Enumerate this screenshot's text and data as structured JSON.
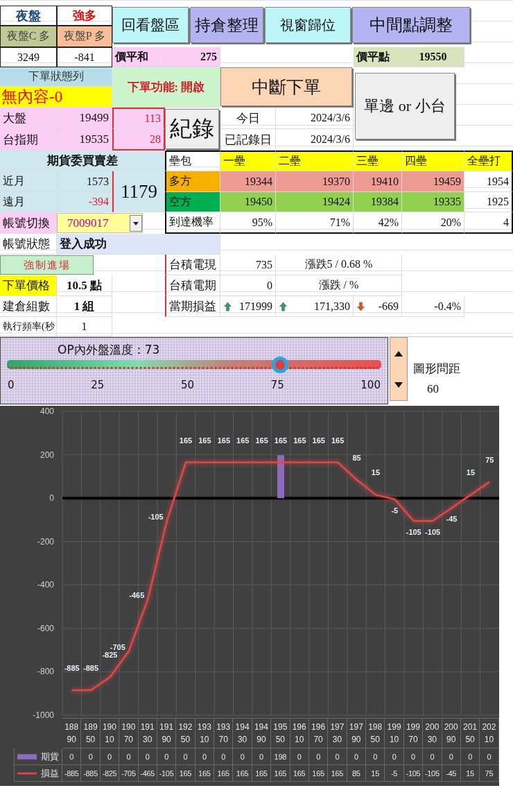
{
  "night": {
    "title": "夜盤",
    "bias": "強多",
    "call_label": "夜盤C 多",
    "put_label": "夜盤P 多",
    "call_value": "3249",
    "put_value": "-841"
  },
  "toolbar_buttons": [
    "回看盤區",
    "持倉整理",
    "視窗歸位",
    "中間點調整"
  ],
  "atm_sum": {
    "label": "價平和",
    "value": "275"
  },
  "atm_point": {
    "label": "價平點",
    "value": "19550"
  },
  "order_status": {
    "header": "下單狀態列",
    "message": "無內容-0"
  },
  "order_function": "下單功能: 開啟",
  "stop_button": "中斷下單",
  "side_button": "單邊 or 小台",
  "record_button": "紀錄",
  "index": [
    {
      "label": "大盤",
      "value": "19499",
      "diff": "113"
    },
    {
      "label": "台指期",
      "value": "19535",
      "diff": "28"
    }
  ],
  "dates": [
    {
      "label": "今日",
      "value": "2024/3/6"
    },
    {
      "label": "已記錄日",
      "value": "2024/3/6"
    }
  ],
  "futures_spread": {
    "header": "期貨委買賣差",
    "rows": [
      {
        "label": "近月",
        "value": "1573",
        "negative": false
      },
      {
        "label": "遠月",
        "value": "-394",
        "negative": true
      }
    ],
    "total": "1179"
  },
  "bases": {
    "header": "壘包",
    "columns": [
      "一壘",
      "二壘",
      "三壘",
      "四壘",
      "全壘打"
    ],
    "rows": [
      {
        "kind": "long",
        "label": "多方",
        "values": [
          "19344",
          "19370",
          "19410",
          "19459",
          "1954"
        ]
      },
      {
        "kind": "short",
        "label": "空方",
        "values": [
          "19450",
          "19424",
          "19384",
          "19335",
          "1925"
        ]
      },
      {
        "kind": "prob",
        "label": "到達機率",
        "values": [
          "95%",
          "71%",
          "42%",
          "20%",
          "4"
        ]
      }
    ]
  },
  "account": {
    "switch_label": "帳號切換",
    "account_value": "7009017",
    "status_label": "帳號狀態",
    "status": "登入成功"
  },
  "force_entry_button": "強制進場",
  "order_price": {
    "label": "下單價格",
    "value": "10.5 點"
  },
  "lots": {
    "label": "建倉組數",
    "value": "1 組"
  },
  "frequency": {
    "label": "執行頻率(秒",
    "value": "1"
  },
  "tsmc": [
    {
      "label": "台積電現",
      "value": "735",
      "change": "漲跌5 / 0.68 %"
    },
    {
      "label": "台積電期",
      "value": "0",
      "change": "漲跌 /  %"
    }
  ],
  "pnl": {
    "label": "當期損益",
    "items": [
      {
        "kind": "up",
        "value": "171999"
      },
      {
        "kind": "up",
        "value": "171,330"
      },
      {
        "kind": "down",
        "value": "-669"
      },
      {
        "kind": "plain",
        "value": "-0.4%"
      }
    ]
  },
  "temperature": {
    "title": "OP內外盤溫度：73",
    "level": 0.73,
    "ticks": [
      "0",
      "25",
      "50",
      "75",
      "100"
    ]
  },
  "spacing": {
    "label": "圖形問距",
    "value": "60"
  },
  "chart": {
    "chart_data": {
      "type": "line",
      "categories": [
        "18890",
        "18950",
        "19010",
        "19070",
        "19130",
        "19190",
        "19250",
        "19310",
        "19370",
        "19430",
        "19490",
        "19550",
        "19610",
        "19670",
        "19730",
        "19790",
        "19850",
        "19910",
        "19970",
        "20030",
        "20090",
        "20150",
        "20210"
      ],
      "ylim": [
        -1000,
        400
      ],
      "yticks": [
        -1000,
        -800,
        -600,
        -400,
        -200,
        0,
        200,
        400
      ],
      "data_labels": true,
      "value_labels": [
        "-885",
        "-885",
        "-825",
        "-705",
        "-465",
        "-105",
        "165",
        "165",
        "165",
        "165",
        "165",
        "165",
        "165",
        "165",
        "165",
        "85",
        "15",
        "-5",
        "-105",
        "-105",
        "-45",
        "15",
        "75"
      ],
      "grid": true,
      "legend": "bottom",
      "ref_lines": [
        {
          "axis": "y",
          "value": 0,
          "color": "#000000"
        }
      ],
      "series": [
        {
          "name": "期貨",
          "color": "#8e6bbf",
          "type": "bar",
          "values": [
            0,
            0,
            0,
            0,
            0,
            0,
            0,
            0,
            0,
            0,
            0,
            198,
            0,
            0,
            0,
            0,
            0,
            0,
            0,
            0,
            0,
            0,
            0
          ]
        },
        {
          "name": "損益",
          "color": "#e04848",
          "type": "line",
          "values": [
            -885,
            -885,
            -825,
            -705,
            -465,
            -105,
            165,
            165,
            165,
            165,
            165,
            165,
            165,
            165,
            165,
            85,
            15,
            -5,
            -105,
            -105,
            -45,
            15,
            75
          ]
        }
      ]
    },
    "data_table": [
      {
        "cells": [
          "0",
          "0",
          "0",
          "0",
          "0",
          "0",
          "0",
          "0",
          "0",
          "0",
          "0",
          "198",
          "0",
          "0",
          "0",
          "0",
          "0",
          "0",
          "0",
          "0",
          "0",
          "0",
          "0"
        ]
      },
      {
        "cells": [
          "-885",
          "-885",
          "-825",
          "-705",
          "-465",
          "-105",
          "165",
          "165",
          "165",
          "165",
          "165",
          "165",
          "165",
          "165",
          "165",
          "85",
          "15",
          "-5",
          "-105",
          "-105",
          "-45",
          "15",
          "75"
        ]
      }
    ]
  }
}
